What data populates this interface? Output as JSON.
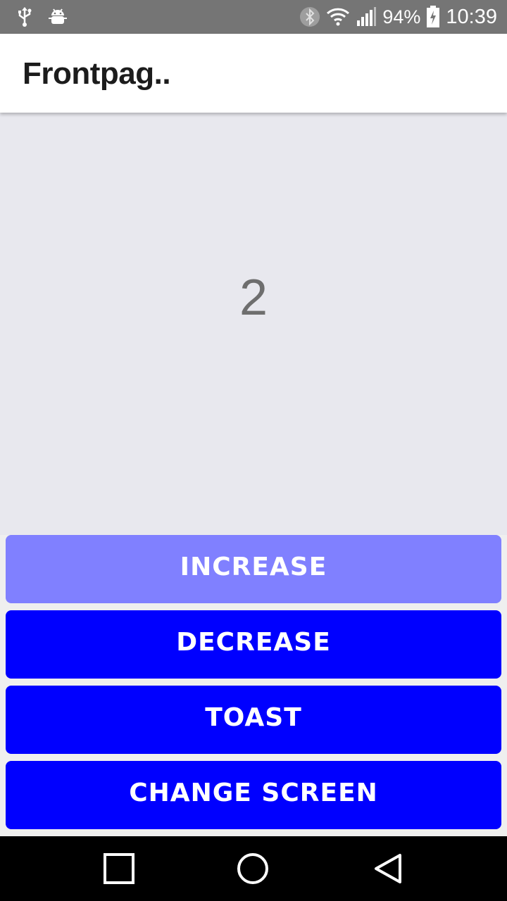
{
  "status_bar": {
    "battery_percent": "94%",
    "time": "10:39",
    "icons": [
      "usb-icon",
      "android-debug-icon",
      "bluetooth-icon",
      "wifi-icon",
      "signal-icon",
      "battery-charging-icon"
    ]
  },
  "app_bar": {
    "title": "Frontpag.."
  },
  "content": {
    "counter_value": "2"
  },
  "buttons": {
    "increase": {
      "label": "INCREASE",
      "enabled": false,
      "color": "#8080ff"
    },
    "decrease": {
      "label": "DECREASE",
      "enabled": true,
      "color": "#0000ff"
    },
    "toast": {
      "label": "TOAST",
      "enabled": true,
      "color": "#0000ff"
    },
    "change_screen": {
      "label": "CHANGE SCREEN",
      "enabled": true,
      "color": "#0000ff"
    }
  },
  "nav_bar": {
    "icons": [
      "recents-square-icon",
      "home-circle-icon",
      "back-triangle-icon"
    ]
  }
}
